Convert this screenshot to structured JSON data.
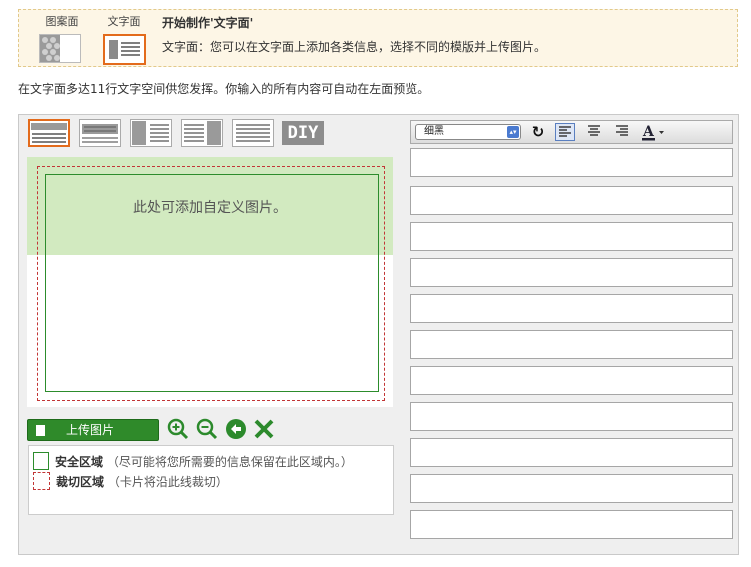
{
  "banner": {
    "tabs": [
      {
        "label": "图案面",
        "selected": false
      },
      {
        "label": "文字面",
        "selected": true
      }
    ],
    "title": "开始制作'文字面'",
    "description": "文字面：您可以在文字面上添加各类信息，选择不同的模版并上传图片。"
  },
  "intro": "在文字面多达11行文字空间供您发挥。你输入的所有内容可自动在左面预览。",
  "layouts": {
    "items": [
      {
        "name": "layout-1",
        "selected": true
      },
      {
        "name": "layout-2",
        "selected": false
      },
      {
        "name": "layout-3",
        "selected": false
      },
      {
        "name": "layout-4",
        "selected": false
      },
      {
        "name": "layout-5",
        "selected": false
      }
    ],
    "diy_label": "DIY"
  },
  "card": {
    "photo_placeholder": "此处可添加自定义图片。"
  },
  "tools": {
    "upload_label": "上传图片",
    "icons": [
      "zoom-in-icon",
      "zoom-out-icon",
      "rotate-icon",
      "delete-icon"
    ]
  },
  "legend": {
    "safe_title": "安全区域",
    "safe_desc": "（尽可能将您所需要的信息保留在此区域内。）",
    "cut_title": "裁切区域",
    "cut_desc": "（卡片将沿此线裁切）"
  },
  "format_bar": {
    "font": "细黑",
    "buttons": [
      "reset-icon",
      "align-left-icon",
      "align-center-icon",
      "align-right-icon",
      "font-color-icon"
    ],
    "active_align": "left"
  },
  "text_lines": {
    "count": 11,
    "values": [
      "",
      "",
      "",
      "",
      "",
      "",
      "",
      "",
      "",
      "",
      ""
    ]
  },
  "colors": {
    "accent_orange": "#e36b1c",
    "safe_green": "#2c8c2c",
    "cut_red": "#c23636",
    "photo_bg": "#d2eac0"
  }
}
